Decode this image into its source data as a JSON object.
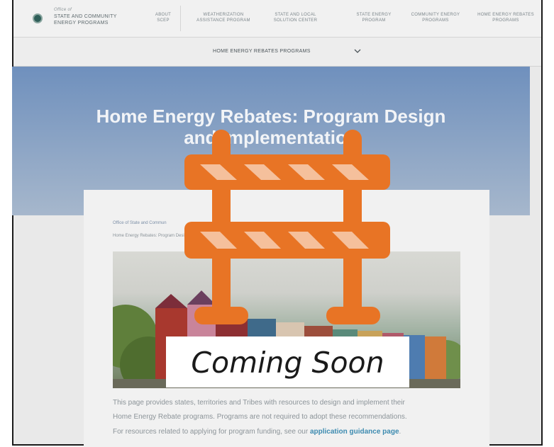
{
  "nav": {
    "office": "Office of",
    "brand_line1": "STATE AND COMMUNITY",
    "brand_line2": "ENERGY PROGRAMS",
    "links": [
      {
        "l1": "ABOUT",
        "l2": "SCEP"
      },
      {
        "l1": "WEATHERIZATION",
        "l2": "ASSISTANCE PROGRAM"
      },
      {
        "l1": "STATE AND LOCAL",
        "l2": "SOLUTION CENTER"
      },
      {
        "l1": "STATE ENERGY",
        "l2": "PROGRAM"
      },
      {
        "l1": "COMMUNITY ENERGY",
        "l2": "PROGRAMS"
      },
      {
        "l1": "HOME ENERGY REBATES",
        "l2": "PROGRAMS"
      }
    ]
  },
  "subnav": {
    "label": "HOME ENERGY REBATES PROGRAMS"
  },
  "hero": {
    "title_line1": "Home Energy Rebates: Program Design",
    "title_line2": "and Implementation"
  },
  "breadcrumb": {
    "item1": "Office of State and Commun",
    "item2": "Home Energy Rebates: Program Design and Implementation"
  },
  "content": {
    "para1_line1": "This page provides states, territories and Tribes with resources to design and implement their",
    "para1_line2": "Home Energy Rebate programs. Programs are not required to adopt these recommendations.",
    "para2_prefix": "For resources related to applying for program funding, see our ",
    "para2_link": "application guidance page",
    "para2_suffix": "."
  },
  "overlay": {
    "label": "Coming Soon",
    "icon": "construction-barrier-icon",
    "color": "#e87425"
  },
  "colors": {
    "hero_top": "#6f90bd",
    "link": "#3d8bb0"
  }
}
